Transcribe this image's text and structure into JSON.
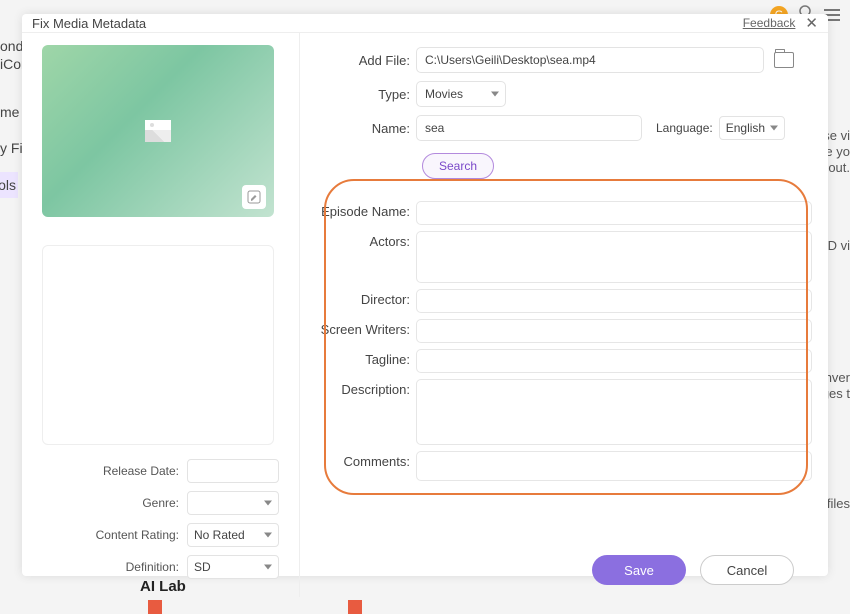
{
  "modal": {
    "title": "Fix Media Metadata",
    "feedback_label": "Feedback"
  },
  "top_form": {
    "add_file_label": "Add File:",
    "add_file_value": "C:\\Users\\Geili\\Desktop\\sea.mp4",
    "type_label": "Type:",
    "type_value": "Movies",
    "name_label": "Name:",
    "name_value": "sea",
    "language_label": "Language:",
    "language_value": "English",
    "search_label": "Search"
  },
  "details": {
    "episode_name_label": "Episode Name:",
    "actors_label": "Actors:",
    "director_label": "Director:",
    "screen_writers_label": "Screen Writers:",
    "tagline_label": "Tagline:",
    "description_label": "Description:",
    "comments_label": "Comments:"
  },
  "left_fields": {
    "release_date_label": "Release Date:",
    "genre_label": "Genre:",
    "content_rating_label": "Content Rating:",
    "content_rating_value": "No Rated",
    "definition_label": "Definition:",
    "definition_value": "SD"
  },
  "buttons": {
    "save": "Save",
    "cancel": "Cancel"
  },
  "background": {
    "sidebar_1": "onde",
    "sidebar_2": "iCor",
    "sidebar_3": "me",
    "sidebar_4": "y Fil",
    "sidebar_5": "ols",
    "ai_lab": "AI Lab",
    "right_1": "ise vi",
    "right_2": "ke yo",
    "right_3": "out.",
    "right_4": "ID vi",
    "right_5": "nver",
    "right_6": "ges t",
    "right_7": "r files",
    "avatar_letter": "G"
  }
}
